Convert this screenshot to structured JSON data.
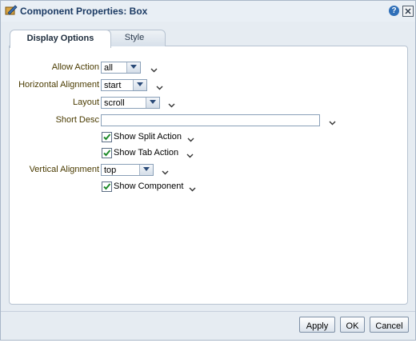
{
  "dialog": {
    "title": "Component Properties: Box",
    "help_glyph": "?",
    "icons": {
      "title": "component-edit-icon",
      "help": "help-icon",
      "close": "close-icon"
    }
  },
  "tabs": [
    {
      "label": "Display Options",
      "active": true
    },
    {
      "label": "Style",
      "active": false
    }
  ],
  "form": {
    "allow_action": {
      "label": "Allow Action",
      "value": "all"
    },
    "horizontal_alignment": {
      "label": "Horizontal Alignment",
      "value": "start"
    },
    "layout": {
      "label": "Layout",
      "value": "scroll"
    },
    "short_desc": {
      "label": "Short Desc",
      "value": ""
    },
    "show_split_action": {
      "label": "Show Split Action",
      "checked": true
    },
    "show_tab_action": {
      "label": "Show Tab Action",
      "checked": true
    },
    "vertical_alignment": {
      "label": "Vertical Alignment",
      "value": "top"
    },
    "show_component": {
      "label": "Show Component",
      "checked": true
    }
  },
  "buttons": {
    "apply": "Apply",
    "ok": "OK",
    "cancel": "Cancel"
  },
  "colors": {
    "accent": "#2f6fb8",
    "label_text": "#4a3b00",
    "check_green": "#1f8a2a"
  }
}
